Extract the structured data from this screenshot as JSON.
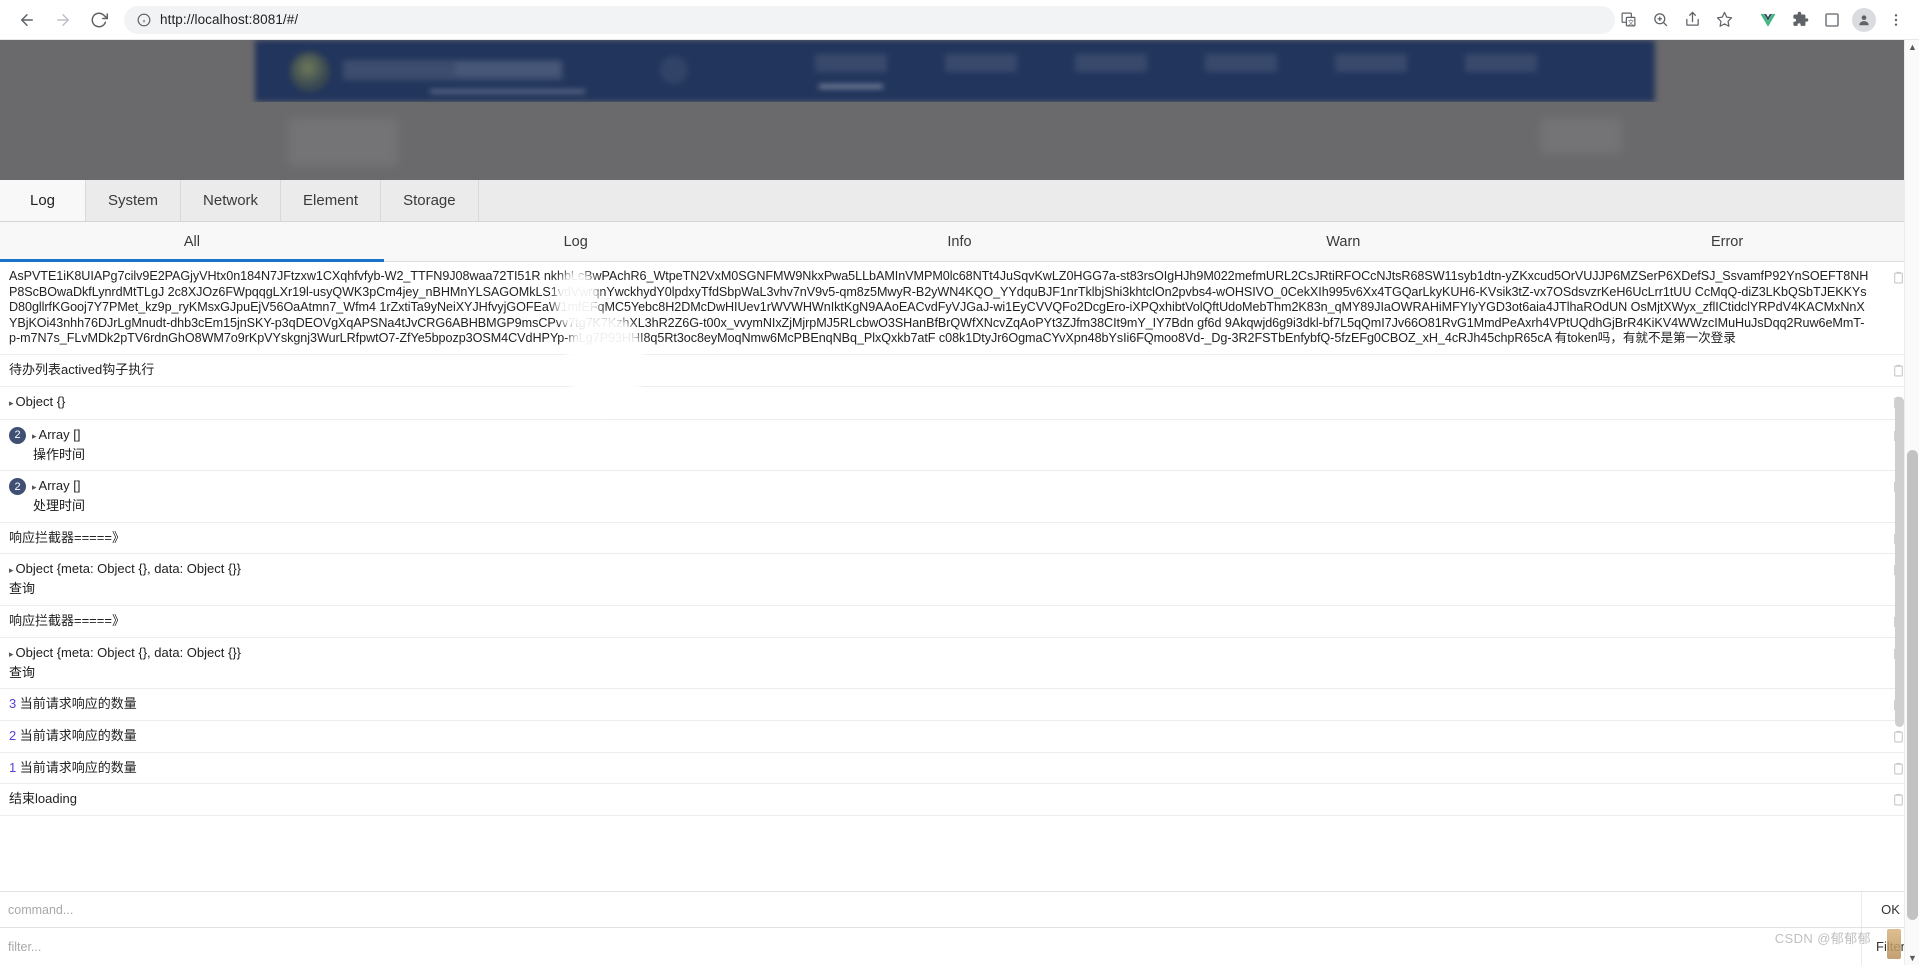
{
  "browser": {
    "back_icon": "back-arrow-icon",
    "forward_icon": "forward-arrow-icon",
    "reload_icon": "reload-icon",
    "site_info_icon": "site-info-icon",
    "url": "http://localhost:8081/#/",
    "toolbar_icons": [
      "translate-icon",
      "zoom-icon",
      "share-icon",
      "bookmark-star-icon",
      "vue-devtools-icon",
      "extensions-puzzle-icon",
      "side-panel-icon",
      "profile-avatar-icon",
      "three-dot-menu-icon"
    ]
  },
  "devtools": {
    "main_tabs": [
      {
        "label": "Log",
        "active": true
      },
      {
        "label": "System",
        "active": false
      },
      {
        "label": "Network",
        "active": false
      },
      {
        "label": "Element",
        "active": false
      },
      {
        "label": "Storage",
        "active": false
      }
    ],
    "filter_tabs": [
      {
        "label": "All",
        "active": true
      },
      {
        "label": "Log",
        "active": false
      },
      {
        "label": "Info",
        "active": false
      },
      {
        "label": "Warn",
        "active": false
      },
      {
        "label": "Error",
        "active": false
      }
    ],
    "accent_color": "#1a73c8",
    "badge_color": "#3f5074",
    "number_color": "#5b3fd4",
    "logs": [
      {
        "type": "token",
        "text": "AsPVTE1iK8UIAPg7cilv9E2PAGjyVHtx0n184N7JFtzxw1CXqhfvfyb-W2_TTFN9J08waa72TI51R nkhbLcBwPAchR6_WtpeTN2VxM0SGNFMW9NkxPwa5LLbAMInVMPM0lc68NTt4JuSqvKwLZ0HGG7a-st83rsOIgHJh9M022mefmURL2CsJRtiRFOCcNJtsR68SW11syb1dtn-yZKxcud5OrVUJJP6MZSerP6XDefSJ_SsvamfP92YnSOEFT8NHP8ScBOwaDkfLynrdMtTLgJ 2c8XJOz6FWpqqgLXr19l-usyQWK3pCm4jey_nBHMnYLSAGOMkLS1vdVwrqnYwckhydY0lpdxyTfdSbpWaL3vhv7nV9v5-qm8z5MwyR-B2yWN4KQO_YYdquBJF1nrTklbjShi3khtclOn2pvbs4-wOHSIVO_0CekXIh995v6Xx4TGQarLkyKUH6-KVsik3tZ-vx7OSdsvzrKeH6UcLrr1tUU CcMqQ-diZ3LKbQSbTJEKKYsD80gllrfKGooj7Y7PMet_kz9p_ryKMsxGJpuEjV56OaAtmn7_Wfm4 1rZxtiTa9yNeiXYJHfvyjGOFEaW1mfEFqMC5Yebc8H2DMcDwHIUev1rWVWHWnIktKgN9AAoEACvdFyVJGaJ-wi1EyCVVQFo2DcgEro-iXPQxhibtVolQftUdoMebThm2K83n_qMY89JIaOWRAHiMFYIyYGD3ot6aia4JTlhaROdUN OsMjtXWyx_zflICtidclYRPdV4KACMxNnXYBjKOi43nhh76DJrLgMnudt-dhb3cEm15jnSKY-p3qDEOVgXqAPSNa4tJvCRG6ABHBMGP9msCPvv7tg7K7KzhXL3hR2Z6G-t00x_vvymNIxZjMjrpMJ5RLcbwO3SHanBfBrQWfXNcvZqAoPYt3ZJfm38CIt9mY_IY7Bdn gf6d 9Akqwjd6g9i3dkl-bf7L5qQmI7Jv66O81RvG1MmdPeAxrh4VPtUQdhGjBrR4KiKV4WWzcIMuHuJsDqq2Ruw6eMmT-p-m7N7s_FLvMDk2pTV6rdnGhO8WM7o9rKpVYskgnj3WurLRfpwtO7-ZfYe5bpozp3OSM4CVdHPYp-mLg7P93HHI8q5Rt3oc8eyMoqNmw6McPBEnqNBq_PlxQxkb7atF c08k1DtyJr6OgmaCYvXpn48bYsIi6FQmoo8Vd-_Dg-3R2FSTbEnfybfQ-5fzEFg0CBOZ_xH_4cRJh45chpR65cA 有token吗，有就不是第一次登录",
        "copy_icon": "copy-icon"
      },
      {
        "type": "plain",
        "text": "待办列表actived钩子执行",
        "copy_icon": "copy-icon"
      },
      {
        "type": "object",
        "arrow": "▸",
        "text": "Object {}",
        "copy_icon": "copy-icon"
      },
      {
        "type": "array",
        "badge": "2",
        "arrow": "▸",
        "text": "Array []",
        "sub": "操作时间",
        "copy_icon": "copy-icon"
      },
      {
        "type": "array",
        "badge": "2",
        "arrow": "▸",
        "text": "Array []",
        "sub": "处理时间",
        "copy_icon": "copy-icon"
      },
      {
        "type": "plain",
        "text": "响应拦截器=====》",
        "copy_icon": "copy-icon"
      },
      {
        "type": "object",
        "arrow": "▸",
        "text": "Object {meta: Object {}, data: Object {}}",
        "sub": "查询",
        "copy_icon": "copy-icon"
      },
      {
        "type": "plain",
        "text": "响应拦截器=====》",
        "copy_icon": "copy-icon"
      },
      {
        "type": "object",
        "arrow": "▸",
        "text": "Object {meta: Object {}, data: Object {}}",
        "sub": "查询",
        "copy_icon": "copy-icon"
      },
      {
        "type": "counted",
        "num": "3",
        "text": "当前请求响应的数量",
        "copy_icon": "copy-icon"
      },
      {
        "type": "counted",
        "num": "2",
        "text": "当前请求响应的数量",
        "copy_icon": "copy-icon"
      },
      {
        "type": "counted",
        "num": "1",
        "text": "当前请求响应的数量",
        "copy_icon": "copy-icon"
      },
      {
        "type": "plain",
        "text": "结束loading",
        "copy_icon": "copy-icon"
      }
    ],
    "command_bar": {
      "placeholder": "command...",
      "button": "OK"
    },
    "filter_bar": {
      "placeholder": "filter...",
      "button": "Filter"
    }
  },
  "watermark": "CSDN @郁郁郁"
}
